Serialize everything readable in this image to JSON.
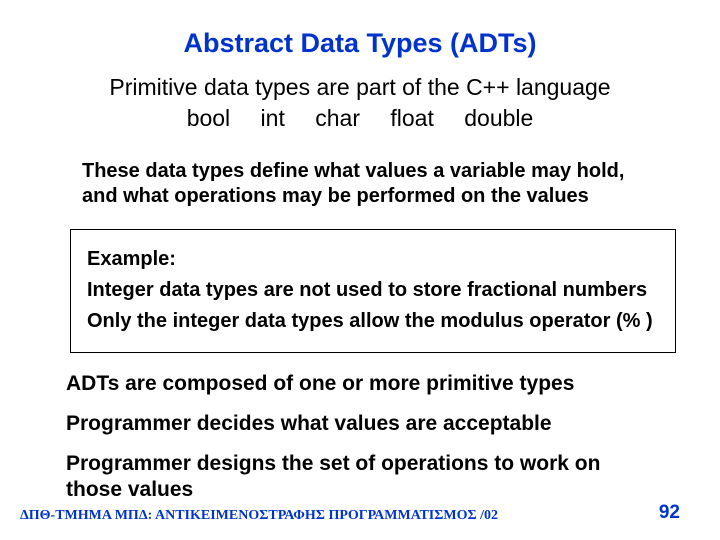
{
  "title": "Abstract Data Types (ADTs)",
  "subtitle_line1": "Primitive data types are part of the C++ language",
  "subtitle_keywords": "bool int char float double",
  "explain": "These data types define what values a variable may hold, and what operations may be performed on the values",
  "example": {
    "heading": "Example:",
    "line1": "Integer data types are not used to store fractional numbers",
    "line2": "Only the integer data types allow the modulus operator (% )"
  },
  "body": {
    "l1": "ADTs are composed of one or more primitive types",
    "l2": "Programmer decides what values are acceptable",
    "l3": "Programmer designs the set of operations to work on those values"
  },
  "footer_left": "ΔΠΘ-ΤΜΗΜΑ ΜΠΔ: ΑΝΤΙΚΕΙΜΕΝΟΣΤΡΑΦΗΣ ΠΡΟΓΡΑΜΜΑΤΙΣΜΟΣ /02",
  "footer_right": "92"
}
